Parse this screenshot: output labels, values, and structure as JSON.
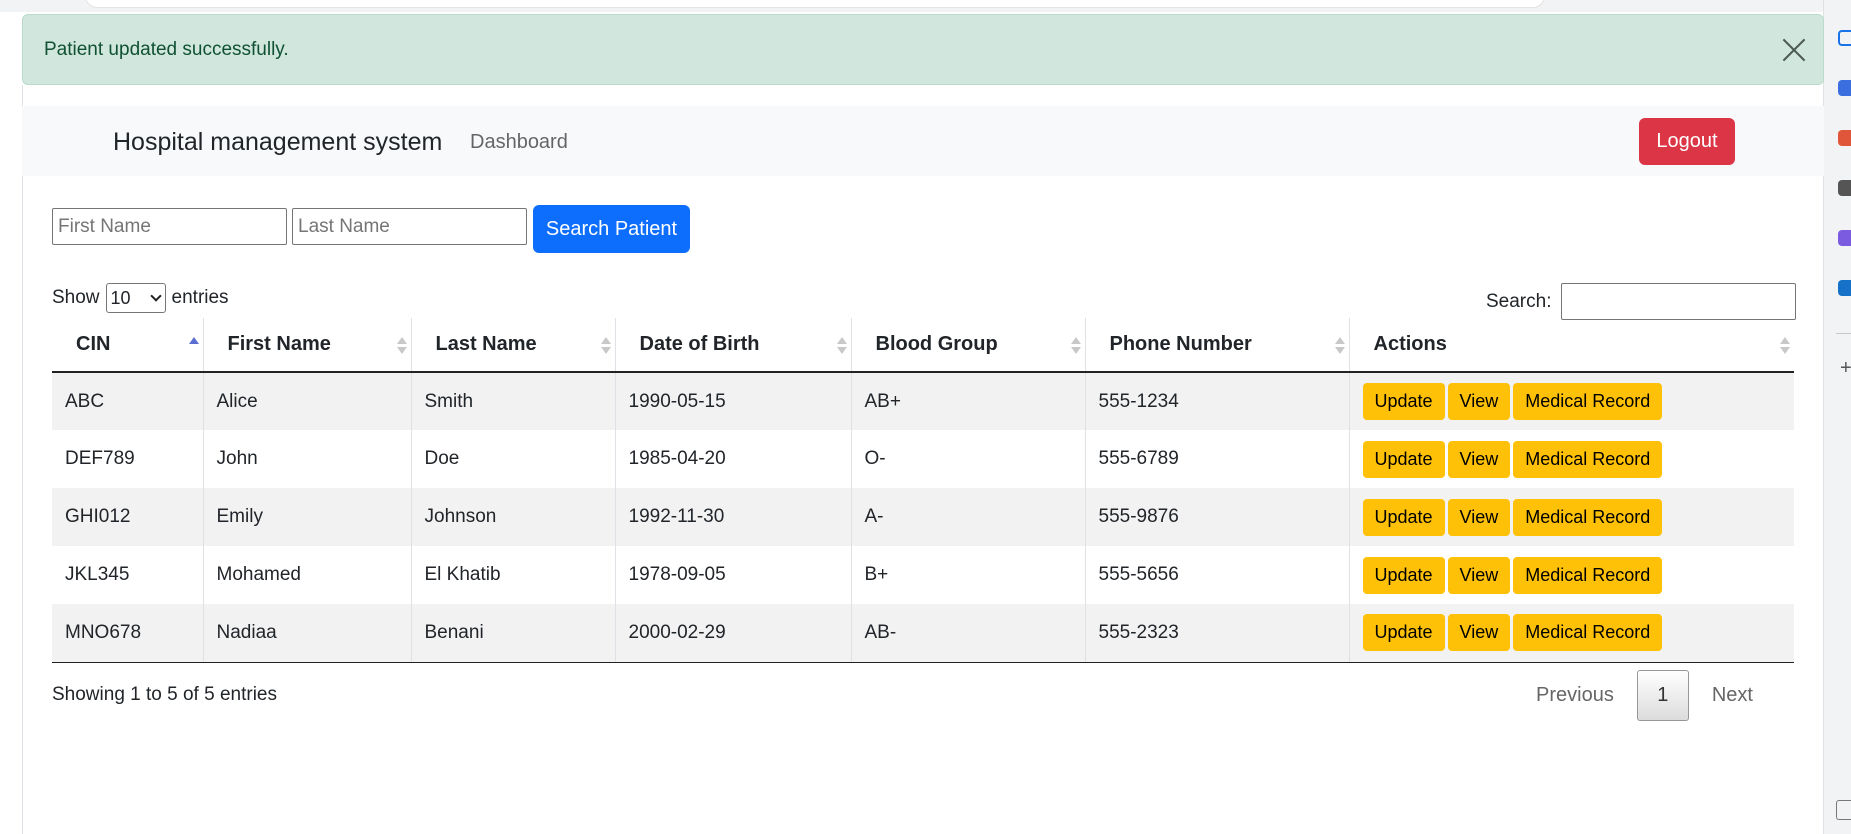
{
  "alert": {
    "message": "Patient updated successfully."
  },
  "navbar": {
    "brand": "Hospital management system",
    "links": [
      "Dashboard"
    ],
    "logout_label": "Logout",
    "logout_color": "#dc3545"
  },
  "search_form": {
    "first_name_placeholder": "First Name",
    "last_name_placeholder": "Last Name",
    "search_label": "Search Patient",
    "button_color": "#0d6efd"
  },
  "datatable": {
    "show_label": "Show",
    "length_value": "10",
    "entries_label": "entries",
    "search_label": "Search:",
    "columns": [
      "CIN",
      "First Name",
      "Last Name",
      "Date of Birth",
      "Blood Group",
      "Phone Number",
      "Actions"
    ],
    "sorted_column": "CIN",
    "rows": [
      [
        "ABC",
        "Alice",
        "Smith",
        "1990-05-15",
        "AB+",
        "555-1234"
      ],
      [
        "DEF789",
        "John",
        "Doe",
        "1985-04-20",
        "O-",
        "555-6789"
      ],
      [
        "GHI012",
        "Emily",
        "Johnson",
        "1992-11-30",
        "A-",
        "555-9876"
      ],
      [
        "JKL345",
        "Mohamed",
        "El Khatib",
        "1978-09-05",
        "B+",
        "555-5656"
      ],
      [
        "MNO678",
        "Nadiaa",
        "Benani",
        "2000-02-29",
        "AB-",
        "555-2323"
      ]
    ],
    "row_actions": [
      "Update",
      "View",
      "Medical Record"
    ],
    "action_color": "#ffc107",
    "info": "Showing 1 to 5 of 5 entries",
    "pagination": {
      "previous": "Previous",
      "current": "1",
      "next": "Next"
    }
  }
}
